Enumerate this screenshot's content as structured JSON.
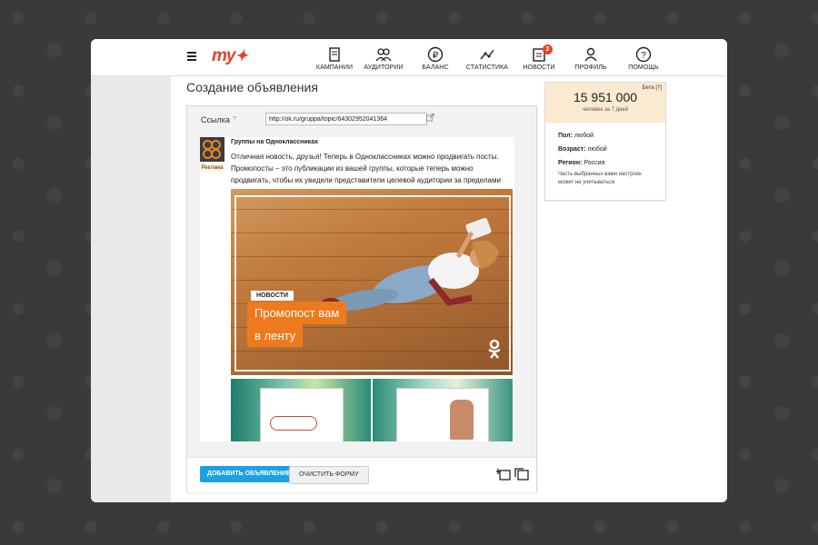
{
  "header": {
    "logo_text": "my",
    "nav": [
      {
        "label": "КАМПАНИИ",
        "icon": "campaigns-icon"
      },
      {
        "label": "АУДИТОРИИ",
        "icon": "audiences-icon"
      },
      {
        "label": "БАЛАНС",
        "icon": "balance-icon"
      },
      {
        "label": "СТАТИСТИКА",
        "icon": "statistics-icon"
      },
      {
        "label": "НОВОСТИ",
        "icon": "news-icon",
        "badge": "2"
      },
      {
        "label": "ПРОФИЛЬ",
        "icon": "profile-icon"
      },
      {
        "label": "ПОМОЩЬ",
        "icon": "help-icon"
      }
    ]
  },
  "page": {
    "title": "Создание объявления"
  },
  "form": {
    "link_label": "Ссылка",
    "link_help": "?",
    "link_value": "http://ok.ru/gruppa/topic/64302952041364"
  },
  "preview": {
    "group_name": "Группы на Одноклассниках",
    "ad_tag": "Реклама",
    "text": "Отличная новость, друзья! Теперь в Одноклассниках можно продвигать посты. Промопосты – это публикации из вашей группы, которые теперь можно продвигать, чтобы их увидели представители целевой аудитории за пределами",
    "image_tag": "НОВОСТИ",
    "image_title_line1": "Промопост вам",
    "image_title_line2": "в ленту"
  },
  "footer": {
    "add_button": "ДОБАВИТЬ ОБЪЯВЛЕНИЕ",
    "clear_button": "ОЧИСТИТЬ ФОРМУ"
  },
  "audience": {
    "beta": "Бета",
    "beta_help": "[?]",
    "count": "15 951 000",
    "caption": "человек за 7 дней",
    "gender_label": "Пол:",
    "gender_value": "любой",
    "age_label": "Возраст:",
    "age_value": "любой",
    "region_label": "Регион:",
    "region_value": "Россия",
    "note": "Часть выбранных вами настроек может не учитываться"
  },
  "colors": {
    "brand": "#e8402a",
    "primary_button": "#1da1e2",
    "promo_orange": "#ee7a1e",
    "audience_bg": "#fbead0"
  }
}
